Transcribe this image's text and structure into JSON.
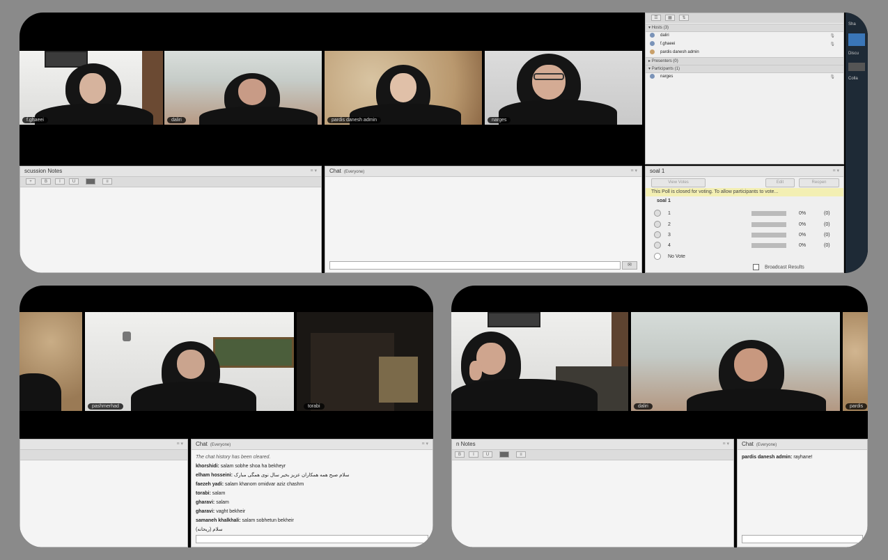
{
  "top": {
    "videos": [
      {
        "name": "f.ghaeei"
      },
      {
        "name": "daliri"
      },
      {
        "name": "pardis danesh admin"
      },
      {
        "name": "narges"
      }
    ],
    "users_panel": {
      "hosts_header": "Hosts (3)",
      "hosts": [
        "daliri",
        "f.ghaeei",
        "pardis danesh admin"
      ],
      "presenters_header": "Presenters (0)",
      "participants_header": "Participants (1)",
      "participants": [
        "narges"
      ],
      "side_labels": [
        "Sha",
        "Discu",
        "Colla"
      ]
    },
    "notes": {
      "title": "scussion Notes"
    },
    "chat": {
      "title": "Chat",
      "scope": "(Everyone)"
    },
    "poll": {
      "title": "soal 1",
      "view_votes": "View Votes",
      "edit": "Edit",
      "reopen": "Reopen",
      "closed_msg": "This Poll is closed for voting. To allow participants to vote...",
      "question": "soal 1",
      "options": [
        {
          "label": "1",
          "pct": "0%",
          "count": "(0)"
        },
        {
          "label": "2",
          "pct": "0%",
          "count": "(0)"
        },
        {
          "label": "3",
          "pct": "0%",
          "count": "(0)"
        },
        {
          "label": "4",
          "pct": "0%",
          "count": "(0)"
        }
      ],
      "no_vote": "No Vote",
      "broadcast": "Broadcast Results"
    }
  },
  "bottom_left": {
    "videos": [
      {
        "name": "pashmerhad"
      },
      {
        "name": "torabi"
      }
    ],
    "chat": {
      "title": "Chat",
      "scope": "(Everyone)",
      "cleared": "The chat history has been cleared.",
      "messages": [
        {
          "user": "khorshidi:",
          "text": "salam sobhe shoa ha bekheyr"
        },
        {
          "user": "elham hosseini:",
          "text": "سلام صبح همه همکاران عزیز بخیر سال نوی همگی مبارک"
        },
        {
          "user": "faezeh yadi:",
          "text": "salam khanom omidvar aziz chashm"
        },
        {
          "user": "torabi:",
          "text": "salam"
        },
        {
          "user": "gharavi:",
          "text": "salam"
        },
        {
          "user": "gharavi:",
          "text": "vaght bekheir"
        },
        {
          "user": "samaneh khalkhali:",
          "text": "salam sobhetun bekheir"
        },
        {
          "user": "",
          "text": "سلام (ریحانه)"
        }
      ]
    }
  },
  "bottom_right": {
    "videos": [
      {
        "name": ""
      },
      {
        "name": "daliri"
      },
      {
        "name": "pardis"
      }
    ],
    "notes": {
      "title": "n Notes"
    },
    "chat": {
      "title": "Chat",
      "scope": "(Everyone)",
      "messages": [
        {
          "user": "pardis danesh admin:",
          "text": "rayhane!"
        }
      ]
    }
  }
}
